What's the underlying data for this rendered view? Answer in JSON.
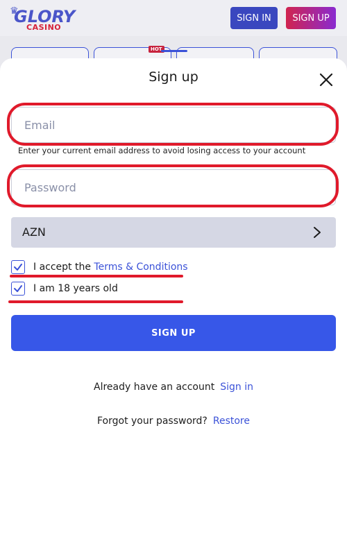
{
  "header": {
    "logo_main": "GLORY",
    "logo_sub": "CASINO",
    "signin_label": "SIGN IN",
    "signup_label": "SIGN UP",
    "hot_badge": "HOT"
  },
  "modal": {
    "title": "Sign up",
    "email": {
      "placeholder": "Email",
      "value": ""
    },
    "email_hint": "Enter your current email address to avoid losing access to your account",
    "password": {
      "placeholder": "Password",
      "value": ""
    },
    "currency": {
      "selected": "AZN"
    },
    "terms": {
      "prefix": "I accept the",
      "link": "Terms & Conditions",
      "checked": true
    },
    "age": {
      "label": "I am 18 years old",
      "checked": true
    },
    "submit_label": "SIGN UP",
    "account": {
      "text": "Already have an account",
      "link": "Sign in"
    },
    "forgot": {
      "text": "Forgot your password?",
      "link": "Restore"
    }
  },
  "colors": {
    "accent": "#3757e8",
    "annotation": "#e01a2b",
    "brand_blue": "#4a55c9",
    "brand_red": "#d6223a"
  },
  "icons": [
    "crown-icon",
    "close-icon",
    "chevron-right-icon",
    "checkmark-icon"
  ]
}
